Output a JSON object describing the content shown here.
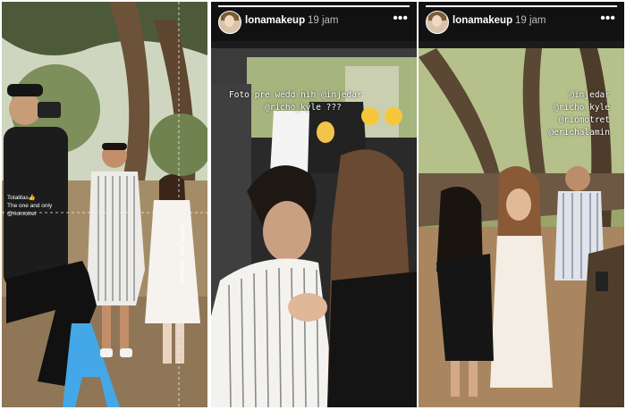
{
  "stories": [
    {
      "caption_lines": [
        "Totalitas👍",
        "The one and only",
        "@riomotret"
      ],
      "vertical_tags": [
        "@richo_kyle",
        "@injedar"
      ]
    },
    {
      "username": "lonamakeup",
      "time": "19 jam",
      "more_icon": "•••",
      "caption_line1": "Foto pre wedd nih @injedar",
      "caption_line2": "@richo_kyle ???"
    },
    {
      "username": "lonamakeup",
      "time": "19 jam",
      "more_icon": "•••",
      "tags": [
        "@injedar",
        "@richo_kyle",
        "@riomotret",
        "@erichalamin"
      ]
    }
  ],
  "colors": {
    "header_bg": "#111111",
    "progress_fill": "#ffffff",
    "username": "#ffffff",
    "time": "#bdbdbd"
  }
}
